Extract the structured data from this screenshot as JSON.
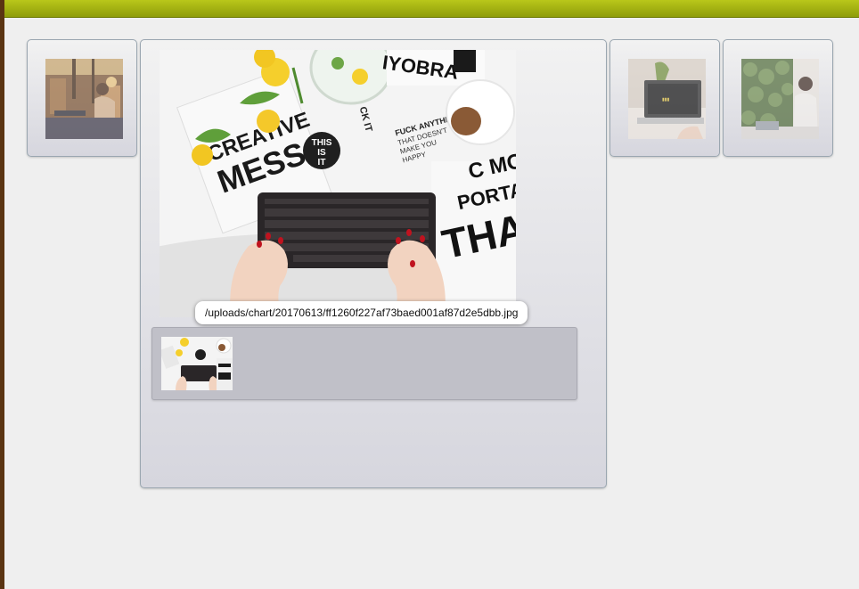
{
  "colors": {
    "top_bar": "#a7b512",
    "left_edge": "#5a3412",
    "page_background": "#efefef",
    "filmstrip_background": "#c0c0c8"
  },
  "gallery": {
    "selected_image": {
      "path": "/uploads/chart/20170613/ff1260f227af73baed001af87d2e5dbb.jpg",
      "printed_texts": {
        "creative": "CREATIVE",
        "mess": "MESS",
        "this": "THIS",
        "is": "IS",
        "it": "IT",
        "ck_it": "CK IT",
        "yobra": "IYOBRA",
        "fuck_anything": "FUCK ANYTHING",
        "that_doesnt": "THAT DOESN'T",
        "make_you": "MAKE YOU",
        "happy": "HAPPY",
        "c_mo": "C MO",
        "portan": "PORTAN",
        "than": "THAN"
      }
    },
    "thumbnails": [
      {
        "subject": "cafe-interior"
      },
      {
        "subject": "laptop-desk"
      },
      {
        "subject": "woman-plant-wall"
      }
    ],
    "filmstrip": [
      {
        "subject": "keyboard-desk"
      }
    ]
  }
}
